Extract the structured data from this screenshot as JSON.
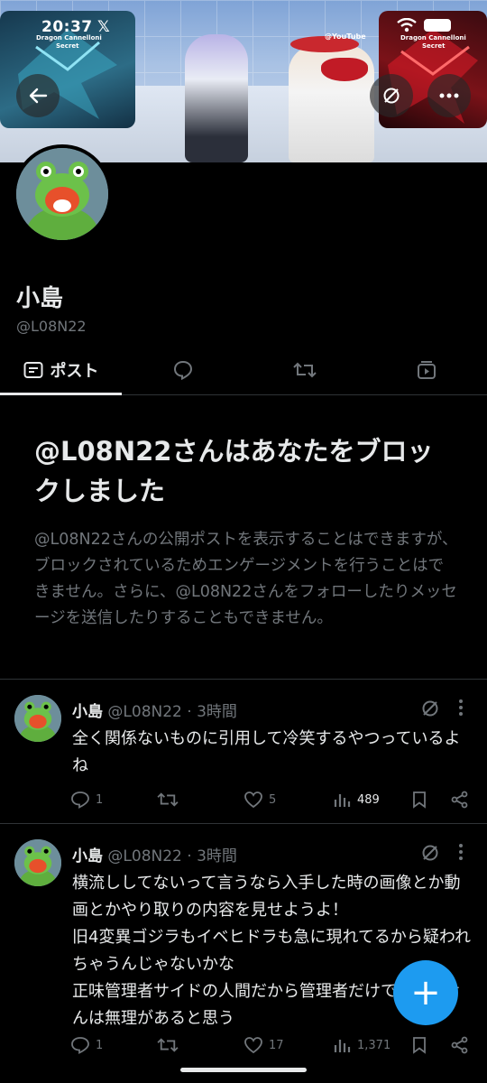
{
  "status_bar": {
    "time": "20:37",
    "x_logo": "𝕏"
  },
  "banner": {
    "card_left_label": "Dragon Cannelloni",
    "card_left_sub": "Secret",
    "card_right_label": "Dragon Cannelloni",
    "card_right_sub": "Secret",
    "overlay_text": "@YouTube"
  },
  "profile": {
    "name": "小島",
    "handle": "@L08N22"
  },
  "tabs": [
    {
      "label": "ポスト",
      "icon": "posts-icon",
      "active": true
    },
    {
      "label": "",
      "icon": "replies-icon"
    },
    {
      "label": "",
      "icon": "reposts-icon"
    },
    {
      "label": "",
      "icon": "media-icon"
    }
  ],
  "blocked": {
    "title": "@L08N22さんはあなたをブロックしました",
    "description": "@L08N22さんの公開ポストを表示することはできますが、ブロックされているためエンゲージメントを行うことはできません。さらに、@L08N22さんをフォローしたりメッセージを送信したりすることもできません。"
  },
  "tweets": [
    {
      "name": "小島",
      "meta": "@L08N22 · 3時間",
      "body": "全く関係ないものに引用して冷笑するやつっているよね",
      "replies": "1",
      "retweets": "",
      "likes": "5",
      "views": "489"
    },
    {
      "name": "小島",
      "meta": "@L08N22 · 3時間",
      "body": "横流ししてないって言うなら入手した時の画像とか動画とかやり取りの内容を見せようよ！\n旧4変異ゴジラもイベヒドラも急に現れてるから疑われちゃうんじゃないかな\n正味管理者サイドの人間だから管理者だけでしてませんは無理があると思う",
      "replies": "1",
      "retweets": "",
      "likes": "17",
      "views": "1,371"
    }
  ],
  "fab": {
    "label": "+"
  },
  "colors": {
    "accent": "#1d9bf0",
    "muted": "#71767b",
    "text": "#e7e9ea",
    "bg": "#000000"
  }
}
